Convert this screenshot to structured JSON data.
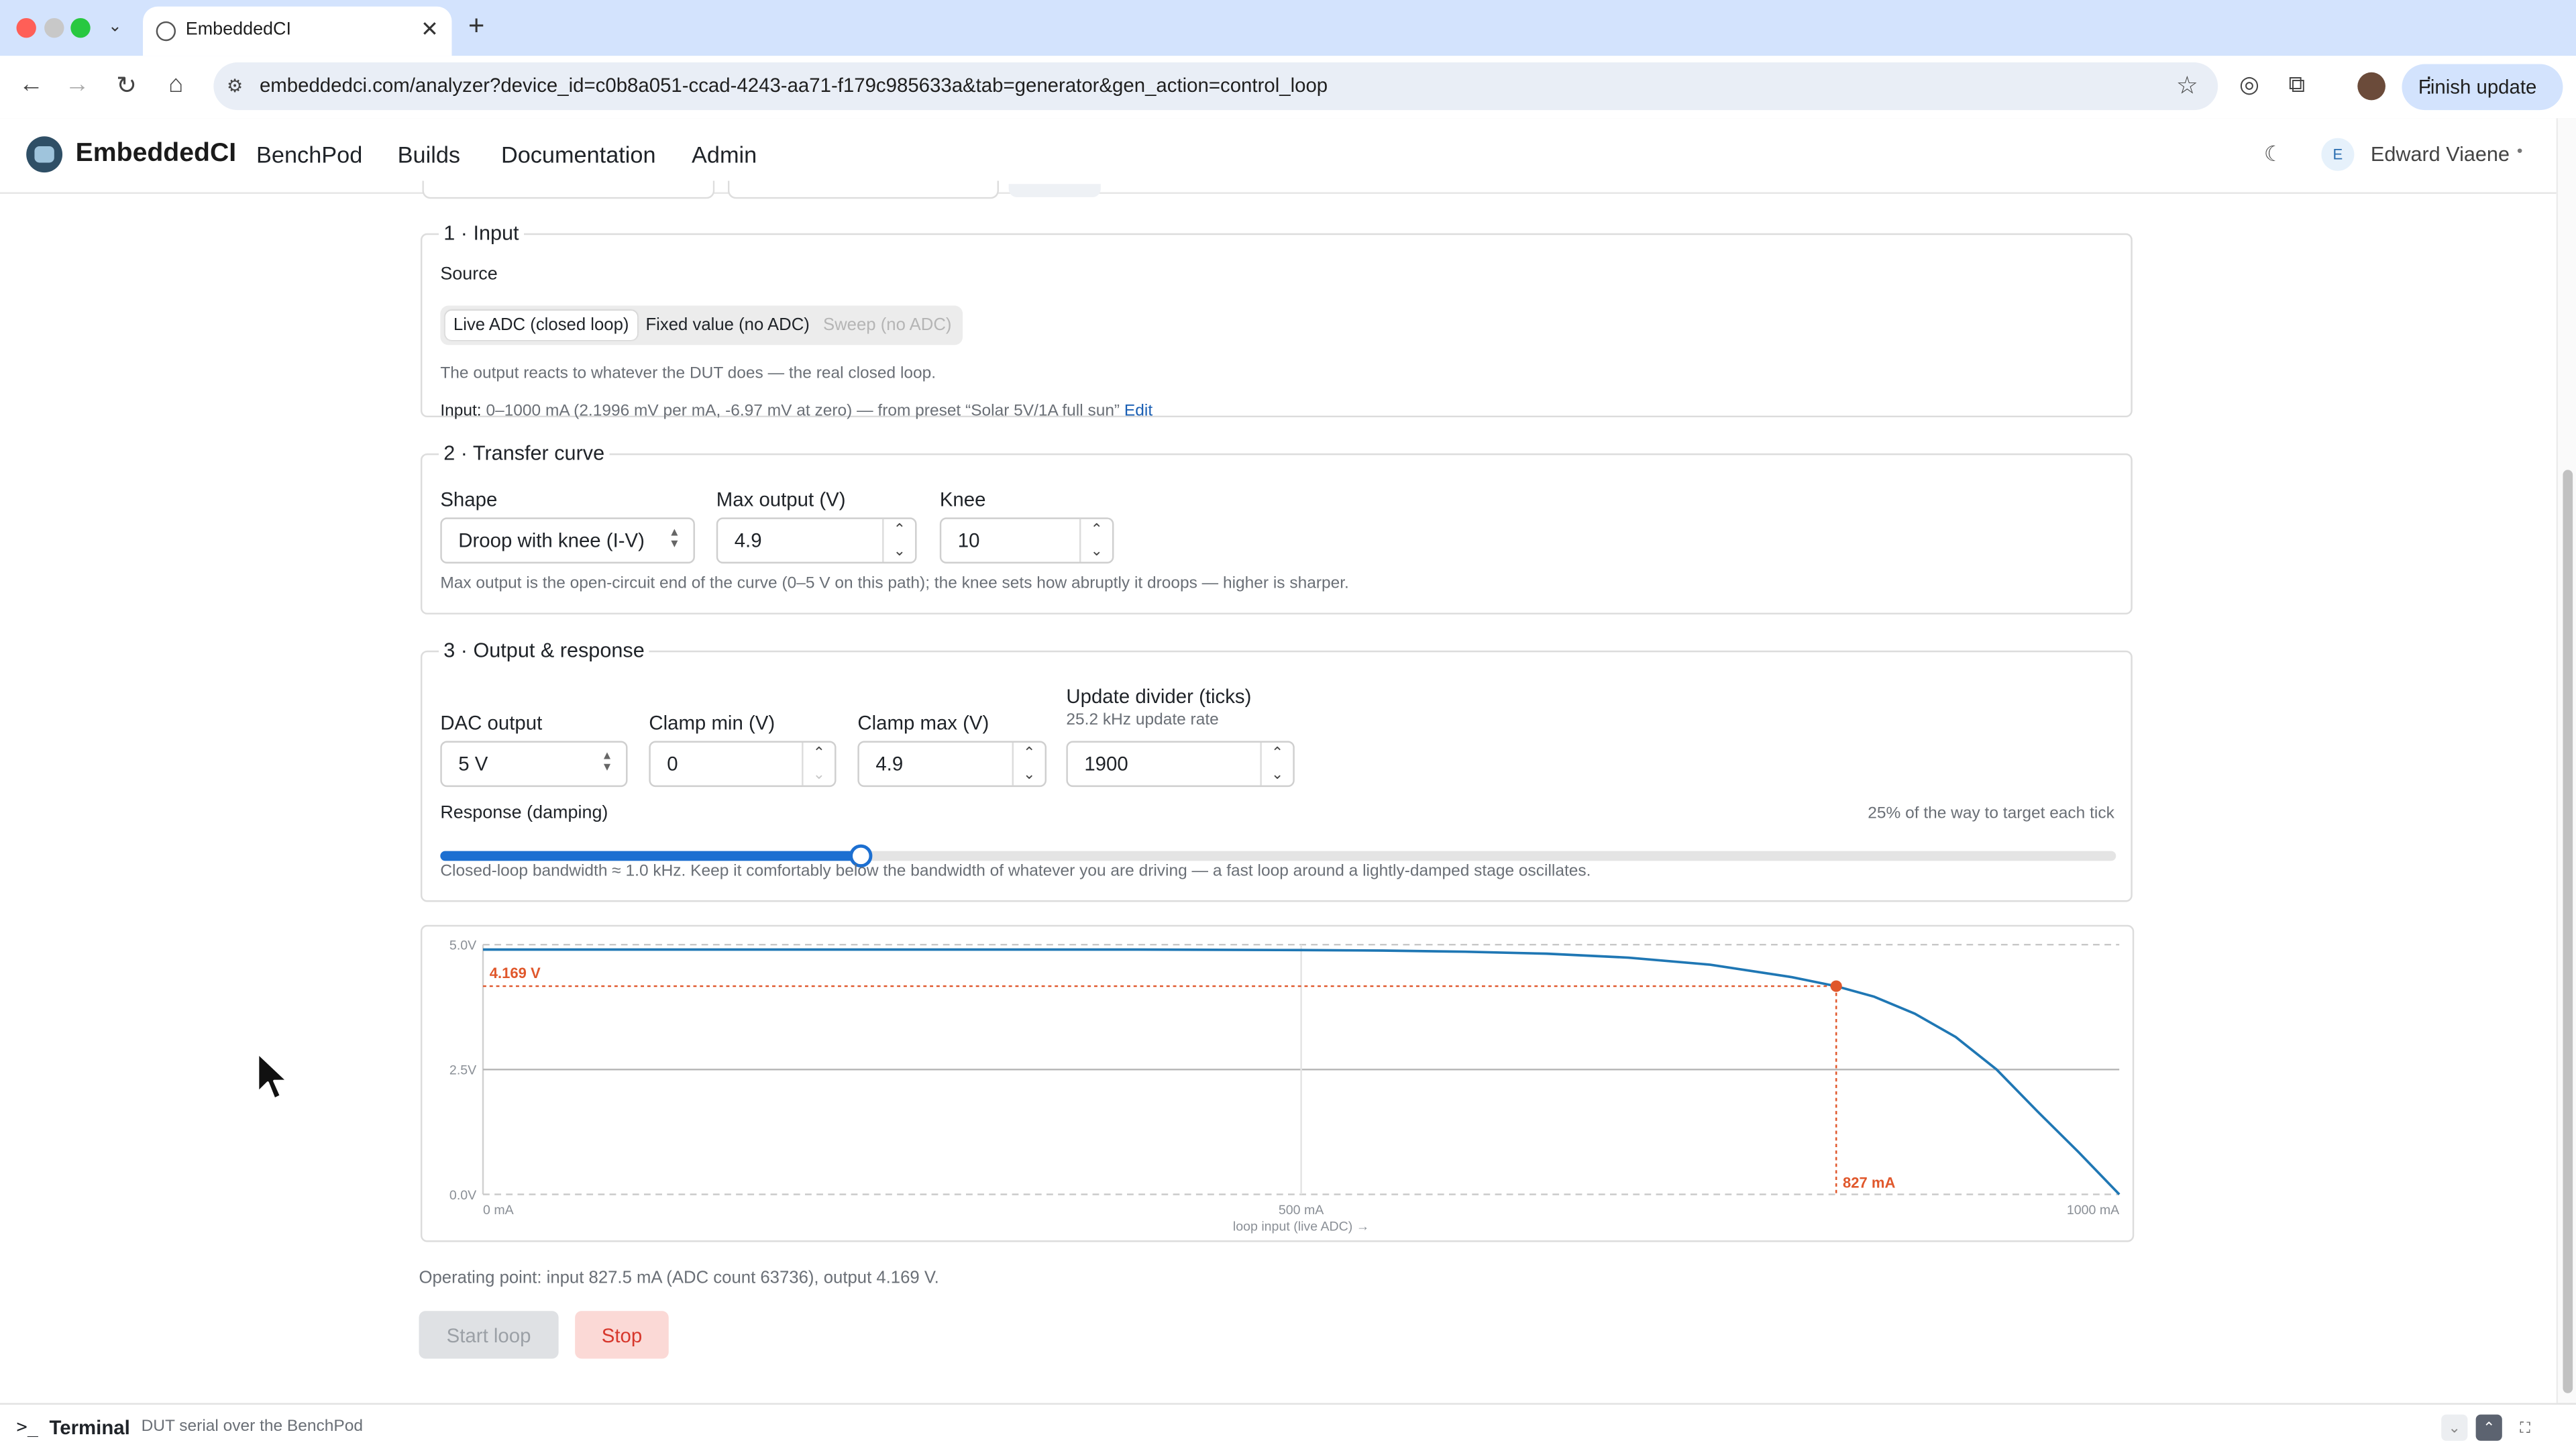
{
  "browser": {
    "tab_title": "EmbeddedCI",
    "url": "embeddedci.com/analyzer?device_id=c0b8a051-ccad-4243-aa71-f179c985633a&tab=generator&gen_action=control_loop",
    "finish_update": "Finish update"
  },
  "app": {
    "brand": "EmbeddedCI",
    "nav": [
      "BenchPod",
      "Builds",
      "Documentation",
      "Admin"
    ],
    "user_initial": "E",
    "user_name": "Edward Viaene"
  },
  "input_section": {
    "legend": "1 · Input",
    "source_label": "Source",
    "options": [
      "Live ADC (closed loop)",
      "Fixed value (no ADC)",
      "Sweep (no ADC)"
    ],
    "selected_option": "Live ADC (closed loop)",
    "description": "The output reacts to whatever the DUT does — the real closed loop.",
    "input_label": "Input:",
    "input_detail": "0–1000 mA (2.1996 mV per mA, -6.97 mV at zero) — from preset “Solar 5V/1A full sun”",
    "edit_link": "Edit"
  },
  "transfer_section": {
    "legend": "2 · Transfer curve",
    "shape_label": "Shape",
    "shape_value": "Droop with knee (I-V)",
    "max_output_label": "Max output (V)",
    "max_output_value": "4.9",
    "knee_label": "Knee",
    "knee_value": "10",
    "help": "Max output is the open-circuit end of the curve (0–5 V on this path); the knee sets how abruptly it droops — higher is sharper."
  },
  "output_section": {
    "legend": "3 · Output & response",
    "dac_label": "DAC output",
    "dac_value": "5 V",
    "clamp_min_label": "Clamp min (V)",
    "clamp_min_value": "0",
    "clamp_max_label": "Clamp max (V)",
    "clamp_max_value": "4.9",
    "divider_label": "Update divider (ticks)",
    "divider_sub": "25.2 kHz update rate",
    "divider_value": "1900",
    "response_label": "Response (damping)",
    "response_hint": "25% of the way to target each tick",
    "response_fraction": 0.25,
    "bandwidth_help": "Closed-loop bandwidth ≈ 1.0 kHz. Keep it comfortably below the bandwidth of whatever you are driving — a fast loop around a lightly-damped stage oscillates."
  },
  "chart_data": {
    "type": "line",
    "xlabel": "loop input (live ADC) →",
    "x_tick_labels": [
      "0 mA",
      "500 mA",
      "1000 mA"
    ],
    "x_ticks": [
      0,
      500,
      1000
    ],
    "y_tick_labels": [
      "0.0V",
      "2.5V",
      "5.0V"
    ],
    "y_ticks": [
      0,
      2.5,
      5.0
    ],
    "xlim": [
      0,
      1000
    ],
    "ylim": [
      0,
      5.0
    ],
    "series": [
      {
        "x": [
          0,
          100,
          200,
          300,
          400,
          500,
          550,
          600,
          650,
          700,
          750,
          800,
          827,
          850,
          875,
          900,
          925,
          950,
          975,
          1000
        ],
        "y": [
          4.9,
          4.9,
          4.9,
          4.9,
          4.9,
          4.89,
          4.88,
          4.86,
          4.82,
          4.74,
          4.6,
          4.35,
          4.169,
          3.96,
          3.62,
          3.15,
          2.5,
          1.66,
          0.85,
          0.0
        ]
      }
    ],
    "marker": {
      "x": 827,
      "y": 4.169,
      "x_label": "827 mA",
      "y_label": "4.169 V"
    },
    "colors": {
      "line": "#1f77b4",
      "marker": "#e0572b"
    }
  },
  "operating_point": "Operating point: input 827.5 mA (ADC count 63736), output 4.169 V.",
  "buttons": {
    "start": "Start loop",
    "stop": "Stop"
  },
  "terminal": {
    "prompt": ">_",
    "title": "Terminal",
    "subtitle": "DUT serial over the BenchPod"
  }
}
